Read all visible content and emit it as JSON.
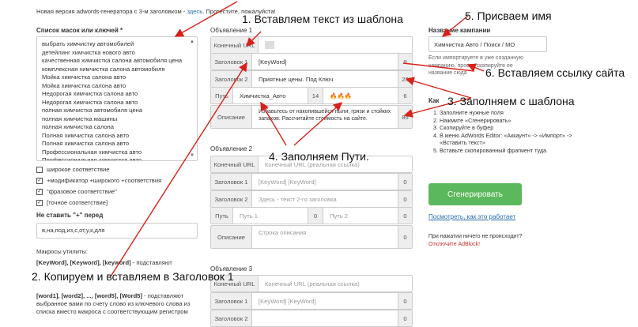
{
  "top_notice": {
    "text": "Новая версия adwords-генератора с 3-м заголовком -",
    "link": "здесь",
    "tail": "Протестите, пожалуйста!"
  },
  "left": {
    "keywords_heading": "Список масок или ключей *",
    "keywords": [
      "выбрать химчистку автомобилей",
      "детейлинг химчистка нового авто",
      "качественная химчистка салона автомобиля цена",
      "комплексная химчистка салона автомобиля",
      "Мойка химчистка салона авто",
      "Мойка химчистка салона авто",
      "Недорогая химчистка салона авто",
      "Недорогая химчистка салона авто",
      "полная химчистка автомобиля цена",
      "полная химчистка машины",
      "полная химчистка салона",
      "Полная химчистка салона авто",
      "Полная химчистка салона авто",
      "Профессиональная химчистка авто",
      "Профессиональная химчистка авто"
    ],
    "match_types": [
      {
        "label": "широкое соответствие",
        "checked": false
      },
      {
        "label": "+модификатор +широкого +соответствия",
        "checked": true
      },
      {
        "label": "\"фразовое соответствие\"",
        "checked": true
      },
      {
        "label": "[точное соответствие]",
        "checked": true
      }
    ],
    "no_plus_label": "Не ставить \"+\" перед",
    "no_plus_value": "в,на,под,из,с,от,у,к,для",
    "macros_heading": "Макросы утилиты:",
    "macro1_bold": "[KeyWord], [Keyword], [keyword]",
    "macro1_text": " - подставляют",
    "macro2_bold": "[word1], [word2], ..., [word5], [Word5]",
    "macro2_text": " - подставляют выбранное вами по счету слово из ключевого слова из",
    "macro2_text2": "списка вместо макроса с соответствующим регистром"
  },
  "ad1": {
    "heading": "Объявление 1",
    "url_label": "Конечный URL",
    "h1_label": "Заголовок 1",
    "h1_value": "[KeyWord]",
    "h1_count": "9",
    "h2_label": "Заголовок 2",
    "h2_value": "Приятные цены. Под Ключ",
    "h2_count": "23",
    "path_label": "Путь",
    "path1_value": "Химчистка_Авто",
    "path1_count": "14",
    "path2_value": "🔥🔥🔥",
    "path2_count": "6",
    "desc_label": "Описание",
    "desc_value": "Избавьтесь от накопившейся пыли, грязи и стойких запахов. Рассчитайте стоимость на сайте.",
    "desc_count": "86"
  },
  "ad2": {
    "heading": "Объявление 2",
    "url_label": "Конечный URL",
    "url_ph": "Конечный URL (реальная ссылка)",
    "h1_label": "Заголовок 1",
    "h1_ph": "[KeyWord] [KeyWord]",
    "h1_count": "0",
    "h2_label": "Заголовок 2",
    "h2_ph": "Здесь - текст 2-го заголовка",
    "h2_count": "0",
    "path_label": "Путь",
    "path1_ph": "Путь 1",
    "path1_count": "0",
    "path2_ph": "Путь 2",
    "path2_count": "0",
    "desc_label": "Описание",
    "desc_ph": "Строка описания",
    "desc_count": "0"
  },
  "ad3": {
    "heading": "Объявление 3",
    "url_label": "Конечный URL",
    "url_ph": "Конечный URL (реальная ссылка)",
    "h1_label": "Заголовок 1",
    "h1_ph": "[KeyWord] [KeyWord]",
    "h1_count": "0",
    "h2_label": "Заголовок 2",
    "h2_count": "0"
  },
  "right": {
    "campaign_heading": "Название кампании",
    "campaign_value": "Химчистка Авто / Поиск / МО",
    "campaign_note1": "Если импортируете в уже созданную",
    "campaign_note2": "кампанию, просто скопируйте ее",
    "campaign_note3": "название сюда",
    "howto_heading": "Как",
    "steps": [
      "Заполните нужные поля",
      "Нажмите «Сгенерировать»",
      "Скопируйте в буфер",
      "В меню AdWords Editor: «Аккаунт» -> «Импорт» -> «Вставить текст»",
      "Вставьте скопированный фрагмент туда."
    ],
    "generate_label": "Сгенерировать",
    "howto_link": "Посмотреть, как это работает",
    "nothing_q": "При нажатии ничего не происходит?",
    "adblock": "Отключите AdBlock!"
  },
  "annotations": {
    "a1": "1. Вставляем текст из шаблона",
    "a2": "2. Копируем и вставляем в Заголовок 1",
    "a3": "3. Заполняем с шаблона",
    "a4": "4. Заполняем Пути.",
    "a5": "5. Присваем имя",
    "a6": "6. Вставляем ссылку сайта"
  },
  "colors": {
    "accent": "#5cb85c",
    "link": "#2a6cb0",
    "arrow": "#d9211a"
  }
}
